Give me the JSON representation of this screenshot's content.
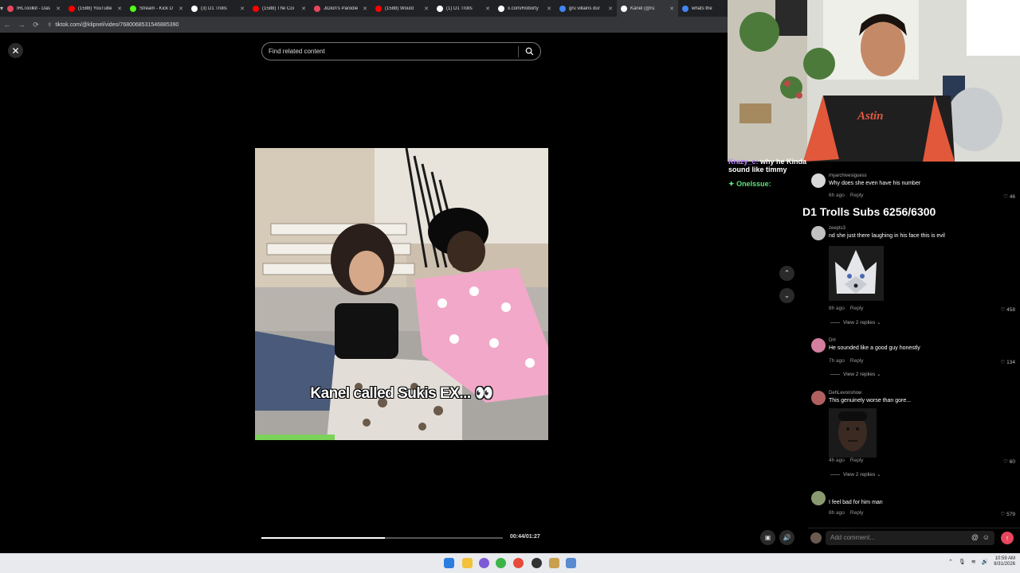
{
  "browser": {
    "tabs": [
      {
        "label": "IRLToolkit - Das",
        "favicon_color": "#e8465f"
      },
      {
        "label": "(1588) YouTube",
        "favicon_color": "#ff0000"
      },
      {
        "label": "Stream - Kick D",
        "favicon_color": "#53fc18"
      },
      {
        "label": "(3) D1 Trolls",
        "favicon_color": "#ffffff"
      },
      {
        "label": "(1588) The Coi",
        "favicon_color": "#ff0000"
      },
      {
        "label": "JiDion's Parodie",
        "favicon_color": "#e8465f"
      },
      {
        "label": "(1588) Would",
        "favicon_color": "#ff0000"
      },
      {
        "label": "(1) D1 Trolls",
        "favicon_color": "#ffffff"
      },
      {
        "label": "x.com/Roborty",
        "favicon_color": "#ffffff"
      },
      {
        "label": "gru villains dur",
        "favicon_color": "#4285f4"
      },
      {
        "label": "Kanel (@ru",
        "favicon_color": "#ffffff",
        "active": true
      },
      {
        "label": "whats the",
        "favicon_color": "#4285f4"
      }
    ],
    "url": "tiktok.com/@klipnel/video/7680068531546885390"
  },
  "tiktok": {
    "search_placeholder": "Find related content",
    "caption": "Kanel called Sukis EX... 👀",
    "time": "00:44/01:27",
    "progress": 0.51,
    "add_comment_placeholder": "Add comment...",
    "comments": [
      {
        "user": "myarchivesiguess",
        "text": "Why does she even have his number",
        "age": "6h ago",
        "reply": "Reply",
        "likes": "46",
        "avatar_color": "#d8d8d8"
      },
      {
        "user": "zeepts3",
        "text": "nd she just there laughing in his face this is evil",
        "age": "8h ago",
        "reply": "Reply",
        "likes": "458",
        "avatar_color": "#c0c0c0",
        "replies": "View 2 replies"
      },
      {
        "user": "DH",
        "text": "He sounded like a good guy honestly",
        "age": "7h ago",
        "reply": "Reply",
        "likes": "134",
        "avatar_color": "#d47ea0",
        "replies": "View 2 replies"
      },
      {
        "user": "DehLevonshow",
        "text": "This genuinely worse than gore...",
        "age": "4h ago",
        "reply": "Reply",
        "likes": "60",
        "avatar_color": "#b06060",
        "replies": "View 2 replies"
      },
      {
        "user": "",
        "text": "I feel bad for him man",
        "age": "8h ago",
        "reply": "Reply",
        "likes": "579",
        "avatar_color": "#8a9a70"
      }
    ]
  },
  "stream": {
    "chat": [
      {
        "user": "Krazy_c:",
        "message": "why he Kinda sound like timmy",
        "color": "#b07cff"
      },
      {
        "user": "OneIssue:",
        "message": "",
        "color": "#5be37a"
      }
    ],
    "subs_goal": "D1 Trolls Subs 6256/6300",
    "shirt_text": "Astin"
  },
  "taskbar": {
    "clock_time": "10:59 AM",
    "clock_date": "8/31/2026"
  }
}
